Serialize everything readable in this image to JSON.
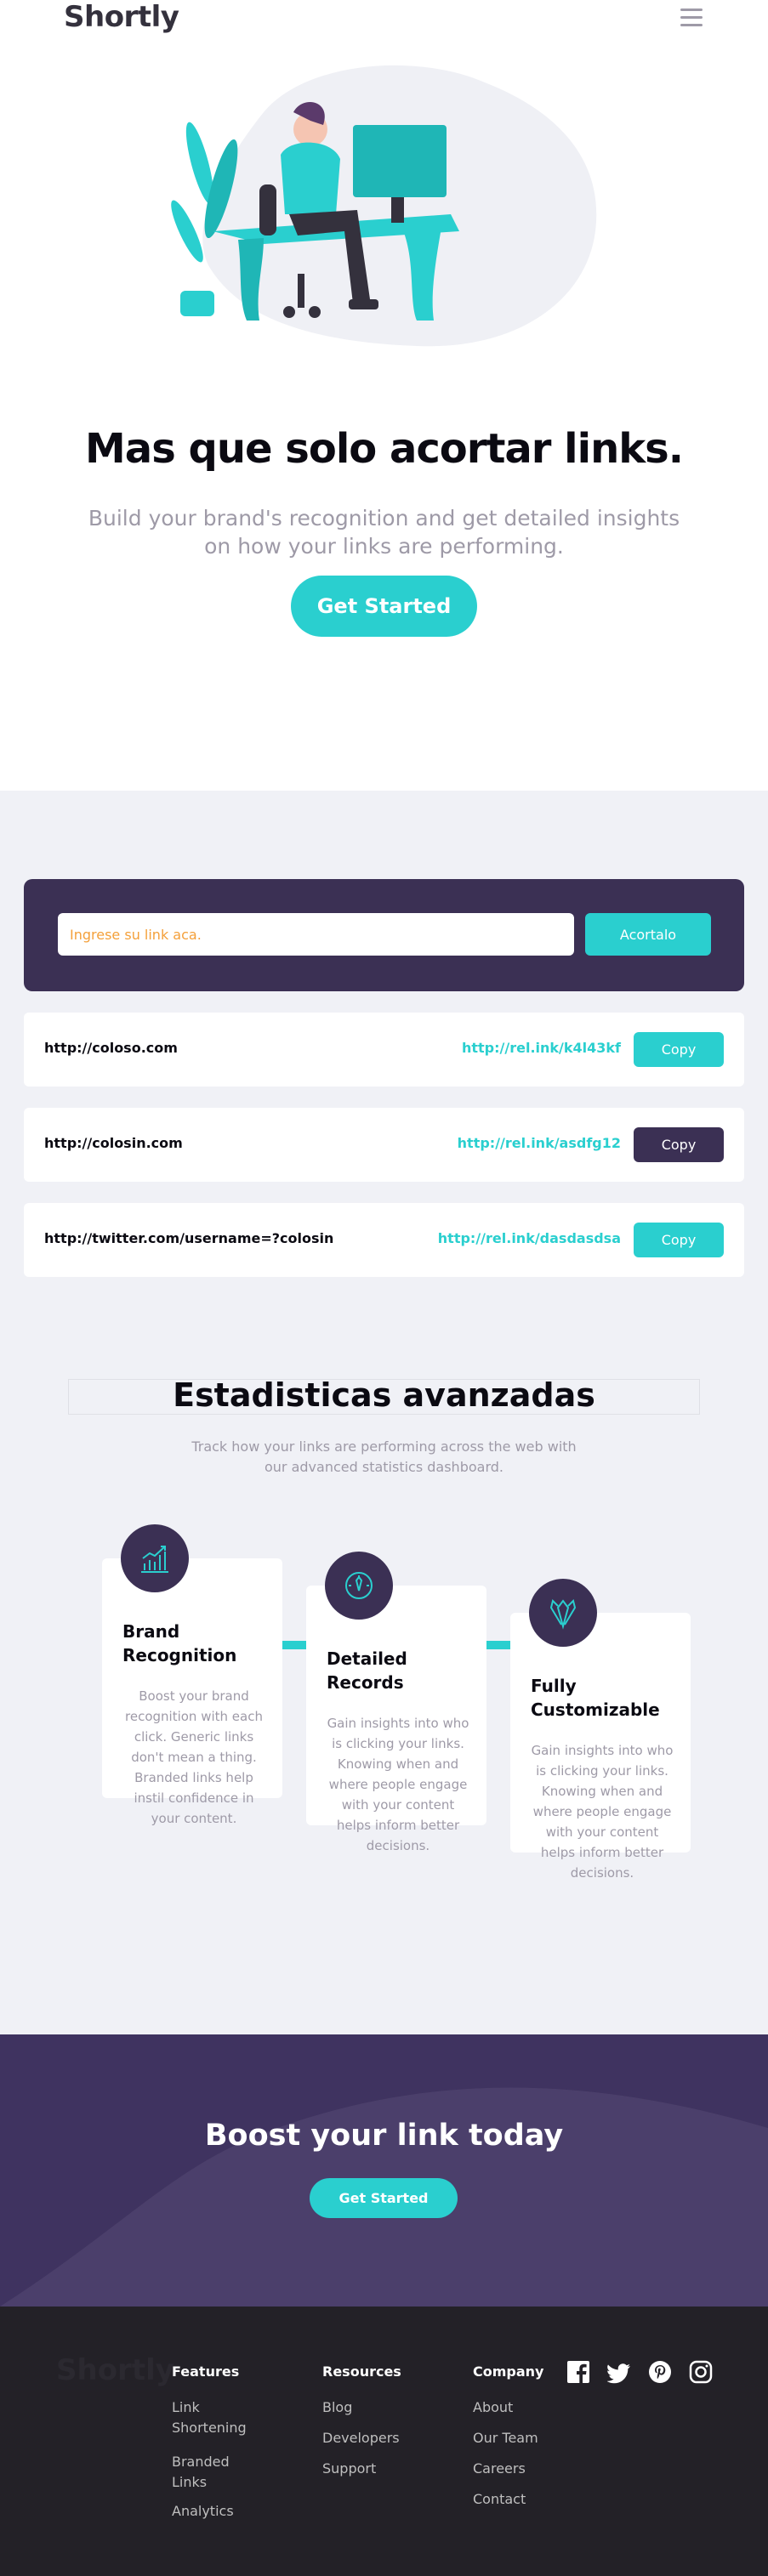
{
  "header": {
    "logo": "Shortly"
  },
  "hero": {
    "title": "Mas que solo acortar links.",
    "subtitle": "Build your brand's recognition and get detailed insights on how your links are performing.",
    "cta": "Get Started"
  },
  "shorten": {
    "placeholder": "Ingrese su link aca.",
    "button": "Acortalo"
  },
  "links": [
    {
      "original": "http://coloso.com",
      "short": "http://rel.ink/k4l43kf",
      "copy": "Copy",
      "copy_color": "#2acfcf"
    },
    {
      "original": "http://colosin.com",
      "short": "http://rel.ink/asdfg12",
      "copy": "Copy",
      "copy_color": "#3b3054"
    },
    {
      "original": "http://twitter.com/username=?colosin",
      "short": "http://rel.ink/dasdasdsa",
      "copy": "Copy",
      "copy_color": "#2acfcf"
    }
  ],
  "stats": {
    "title": "Estadisticas avanzadas",
    "subtitle": "Track how your links are performing across the web with our advanced statistics dashboard.",
    "cards": [
      {
        "icon": "chart-icon",
        "title": "Brand Recognition",
        "body": "Boost your brand recognition with each click. Generic links don't mean a thing. Branded links help instil confidence in your content."
      },
      {
        "icon": "gauge-icon",
        "title": "Detailed Records",
        "body": "Gain insights into who is clicking your links. Knowing when and where people engage with your content helps inform better decisions."
      },
      {
        "icon": "pens-icon",
        "title": "Fully Customizable",
        "body": "Gain insights into who is clicking your links. Knowing when and where people engage with your content helps inform better decisions."
      }
    ]
  },
  "boost": {
    "title": "Boost your link today",
    "button": "Get Started"
  },
  "footer": {
    "logo": "Shortly",
    "columns": [
      {
        "heading": "Features",
        "links": [
          "Link Shortening",
          "Branded Links",
          "Analytics"
        ]
      },
      {
        "heading": "Resources",
        "links": [
          "Blog",
          "Developers",
          "Support"
        ]
      },
      {
        "heading": "Company",
        "links": [
          "About",
          "Our Team",
          "Careers",
          "Contact"
        ]
      }
    ],
    "social": [
      "facebook-icon",
      "twitter-icon",
      "pinterest-icon",
      "instagram-icon"
    ]
  },
  "colors": {
    "primary": "#2acfcf",
    "dark_violet": "#3b3054",
    "gray_bg": "#f0f1f6",
    "footer_bg": "#232127"
  }
}
